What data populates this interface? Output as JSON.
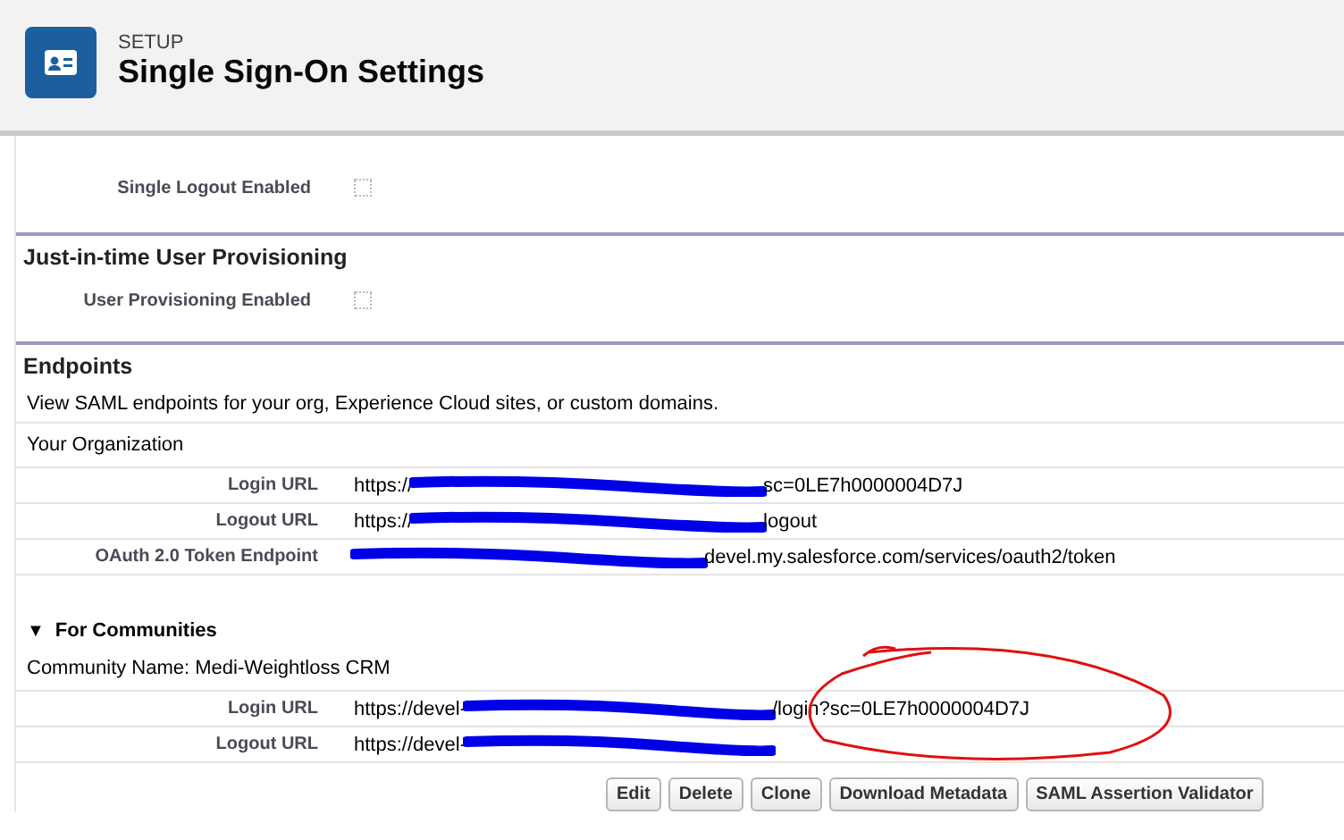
{
  "header": {
    "eyebrow": "SETUP",
    "title": "Single Sign-On Settings"
  },
  "settings_top": [
    {
      "label": "Single Logout Enabled",
      "checked": false
    }
  ],
  "sections": [
    {
      "title": "Just-in-time User Provisioning",
      "fields": [
        {
          "label": "User Provisioning Enabled",
          "checked": false
        }
      ]
    }
  ],
  "endpoints": {
    "title": "Endpoints",
    "description": "View SAML endpoints for your org, Experience Cloud sites, or custom domains.",
    "org_heading": "Your Organization",
    "org_rows": [
      {
        "label": "Login URL",
        "prefix": "https://",
        "suffix": "sc=0LE7h0000004D7J"
      },
      {
        "label": "Logout URL",
        "prefix": "https://",
        "suffix": "logout"
      },
      {
        "label": "OAuth 2.0 Token Endpoint",
        "suffix": "devel.my.salesforce.com/services/oauth2/token"
      }
    ],
    "communities": {
      "toggle": "▼",
      "title": "For Communities",
      "expanded": true,
      "community_name": "Community Name: Medi-Weightloss CRM",
      "rows": [
        {
          "label": "Login URL",
          "prefix": "https://devel-",
          "suffix": "/login?sc=0LE7h0000004D7J",
          "circled": true
        },
        {
          "label": "Logout URL",
          "prefix": "https://devel-",
          "circled": false
        }
      ]
    }
  },
  "buttons": [
    "Edit",
    "Delete",
    "Clone",
    "Download Metadata",
    "SAML Assertion Validator"
  ]
}
